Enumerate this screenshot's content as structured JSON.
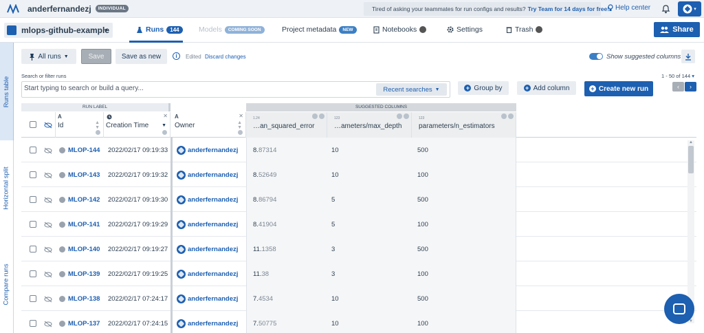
{
  "topbar": {
    "username": "anderfernandezj",
    "account_badge": "INDIVIDUAL",
    "promo_text": "Tired of asking your teammates for run configs and results?",
    "promo_link": "Try Team for 14 days for free!",
    "help_label": "Help center"
  },
  "project": {
    "name": "mlops-github-example"
  },
  "tabs": {
    "runs": {
      "label": "Runs",
      "count": "144"
    },
    "models": {
      "label": "Models",
      "badge": "COMING SOON"
    },
    "metadata": {
      "label": "Project metadata",
      "badge": "NEW"
    },
    "notebooks": {
      "label": "Notebooks"
    },
    "settings": {
      "label": "Settings"
    },
    "trash": {
      "label": "Trash"
    }
  },
  "share_label": "Share",
  "side_tabs": {
    "runs_table": "Runs table",
    "horizontal_split": "Horizontal split",
    "compare_runs": "Compare runs"
  },
  "toolbar": {
    "view_label": "All runs",
    "save_label": "Save",
    "save_as_label": "Save as new",
    "edited_label": "Edited",
    "discard_label": "Discard changes",
    "suggested_toggle_label": "Show suggested columns",
    "suggested_toggle_on": true
  },
  "search": {
    "label": "Search or filter runs",
    "placeholder": "Start typing to search or build a query...",
    "recent_label": "Recent searches"
  },
  "actions": {
    "group_by": "Group by",
    "add_column": "Add column",
    "create_run": "Create new run"
  },
  "pagination": {
    "range": "1 - 50 of 144"
  },
  "table": {
    "group_headers": {
      "run_label": "RUN LABEL",
      "suggested": "SUGGESTED COLUMNS"
    },
    "columns": {
      "id": {
        "type": "A",
        "title": "Id"
      },
      "creation_time": {
        "title": "Creation Time"
      },
      "owner": {
        "type": "A",
        "title": "Owner"
      },
      "mse": {
        "title": "…an_squared_error",
        "numtype": "1.24"
      },
      "max_depth": {
        "title": "…ameters/max_depth",
        "numtype": "123"
      },
      "n_estimators": {
        "title": "parameters/n_estimators",
        "numtype": "123"
      }
    },
    "rows": [
      {
        "id": "MLOP-144",
        "time": "2022/02/17 09:19:33",
        "owner": "anderfernandezj",
        "mse_int": "8.",
        "mse_dec": "87314",
        "depth": "10",
        "est": "500"
      },
      {
        "id": "MLOP-143",
        "time": "2022/02/17 09:19:32",
        "owner": "anderfernandezj",
        "mse_int": "8.",
        "mse_dec": "52649",
        "depth": "10",
        "est": "100"
      },
      {
        "id": "MLOP-142",
        "time": "2022/02/17 09:19:30",
        "owner": "anderfernandezj",
        "mse_int": "8.",
        "mse_dec": "86794",
        "depth": "5",
        "est": "500"
      },
      {
        "id": "MLOP-141",
        "time": "2022/02/17 09:19:29",
        "owner": "anderfernandezj",
        "mse_int": "8.",
        "mse_dec": "41904",
        "depth": "5",
        "est": "100"
      },
      {
        "id": "MLOP-140",
        "time": "2022/02/17 09:19:27",
        "owner": "anderfernandezj",
        "mse_int": "11.",
        "mse_dec": "1358",
        "depth": "3",
        "est": "500"
      },
      {
        "id": "MLOP-139",
        "time": "2022/02/17 09:19:25",
        "owner": "anderfernandezj",
        "mse_int": "11.",
        "mse_dec": "38",
        "depth": "3",
        "est": "100"
      },
      {
        "id": "MLOP-138",
        "time": "2022/02/17 07:24:17",
        "owner": "anderfernandezj",
        "mse_int": "7.",
        "mse_dec": "4534",
        "depth": "10",
        "est": "500"
      },
      {
        "id": "MLOP-137",
        "time": "2022/02/17 07:24:15",
        "owner": "anderfernandezj",
        "mse_int": "7.",
        "mse_dec": "50775",
        "depth": "10",
        "est": "100"
      }
    ]
  },
  "colors": {
    "primary": "#1d5fb0",
    "topbar_bg": "#eef1f5",
    "suggested_bg": "#f5f6f7"
  },
  "icons": {
    "logo": "neptune-logo-icon",
    "promo": "rocket-icon",
    "help": "lightbulb-icon",
    "notifications": "bell-icon",
    "share": "users-icon",
    "pin": "pin-icon",
    "download": "download-icon",
    "hide": "eye-off-icon",
    "chat": "chat-icon"
  }
}
